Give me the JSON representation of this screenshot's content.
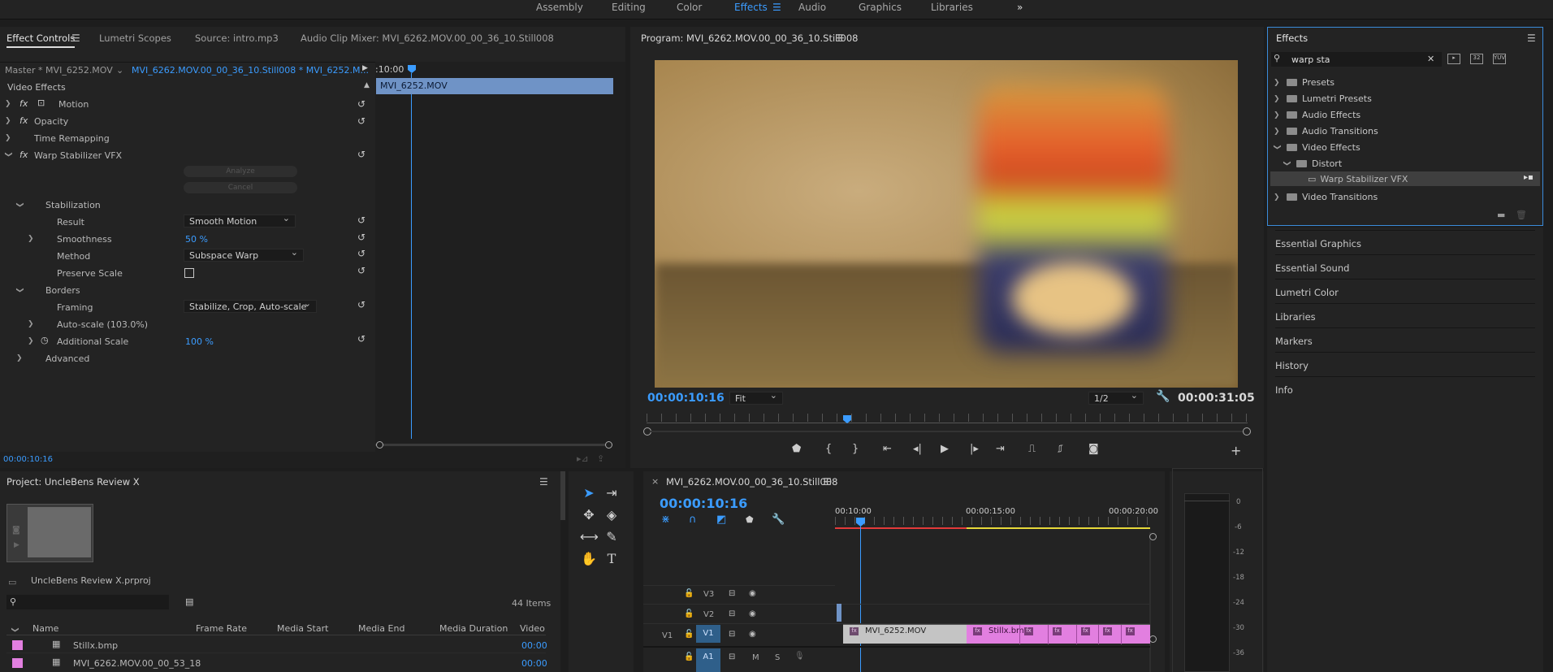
{
  "workspaces": {
    "items": [
      "Assembly",
      "Editing",
      "Color",
      "Effects",
      "Audio",
      "Graphics",
      "Libraries"
    ],
    "active": "Effects",
    "more": "»"
  },
  "effect_controls": {
    "tabs": [
      "Effect Controls",
      "Lumetri Scopes",
      "Source: intro.mp3",
      "Audio Clip Mixer: MVI_6262.MOV.00_00_36_10.Still008"
    ],
    "master_label": "Master * MVI_6252.MOV",
    "sequence_label": "MVI_6262.MOV.00_00_36_10.Still008 * MVI_6252.M...",
    "mini_time": ":10:00",
    "clip_bar": "MVI_6252.MOV",
    "section": "Video Effects",
    "motion": "Motion",
    "opacity": "Opacity",
    "time_remapping": "Time Remapping",
    "warp": "Warp Stabilizer VFX",
    "analyze": "Analyze",
    "cancel": "Cancel",
    "stabilization": "Stabilization",
    "result_label": "Result",
    "result_value": "Smooth Motion",
    "smoothness_label": "Smoothness",
    "smoothness_value": "50 %",
    "method_label": "Method",
    "method_value": "Subspace Warp",
    "preserve_label": "Preserve Scale",
    "borders": "Borders",
    "framing_label": "Framing",
    "framing_value": "Stabilize, Crop, Auto-scale",
    "autoscale": "Auto-scale (103.0%)",
    "addscale_label": "Additional Scale",
    "addscale_value": "100 %",
    "advanced": "Advanced",
    "timecode": "00:00:10:16"
  },
  "program": {
    "title": "Program: MVI_6262.MOV.00_00_36_10.Still008",
    "timecode": "00:00:10:16",
    "fit": "Fit",
    "resolution": "1/2",
    "duration": "00:00:31:05"
  },
  "effects_panel": {
    "title": "Effects",
    "search_value": "warp sta",
    "tree": [
      "Presets",
      "Lumetri Presets",
      "Audio Effects",
      "Audio Transitions",
      "Video Effects",
      "Distort",
      "Warp Stabilizer VFX",
      "Video Transitions"
    ],
    "other_panels": [
      "Essential Graphics",
      "Essential Sound",
      "Lumetri Color",
      "Libraries",
      "Markers",
      "History",
      "Info"
    ]
  },
  "project": {
    "title": "Project: UncleBens Review X",
    "file": "UncleBens Review X.prproj",
    "items_count": "44 Items",
    "columns": [
      "Name",
      "Frame Rate",
      "Media Start",
      "Media End",
      "Media Duration",
      "Video"
    ],
    "rows": [
      {
        "name": "Stillx.bmp",
        "video": "00:00"
      },
      {
        "name": "MVI_6262.MOV.00_00_53_18",
        "video": "00:00"
      }
    ]
  },
  "timeline": {
    "title": "MVI_6262.MOV.00_00_36_10.Still008",
    "timecode": "00:00:10:16",
    "ruler": [
      "00:10:00",
      "00:00:15:00",
      "00:00:20:00"
    ],
    "tracks": [
      "V3",
      "V2",
      "V1",
      "A1"
    ],
    "v1_source": "V1",
    "a1_m": "M",
    "a1_s": "S",
    "clip1": "MVI_6252.MOV",
    "clip2": "Stillx.bmp"
  },
  "meter": {
    "labels": [
      "0",
      "-6",
      "-12",
      "-18",
      "-24",
      "-30",
      "-36"
    ]
  },
  "colors": {
    "accent": "#3b9cff",
    "clip_pink": "#e27fe0",
    "clip_gray": "#c4c4c4",
    "clip_blue": "#6f93c6"
  }
}
